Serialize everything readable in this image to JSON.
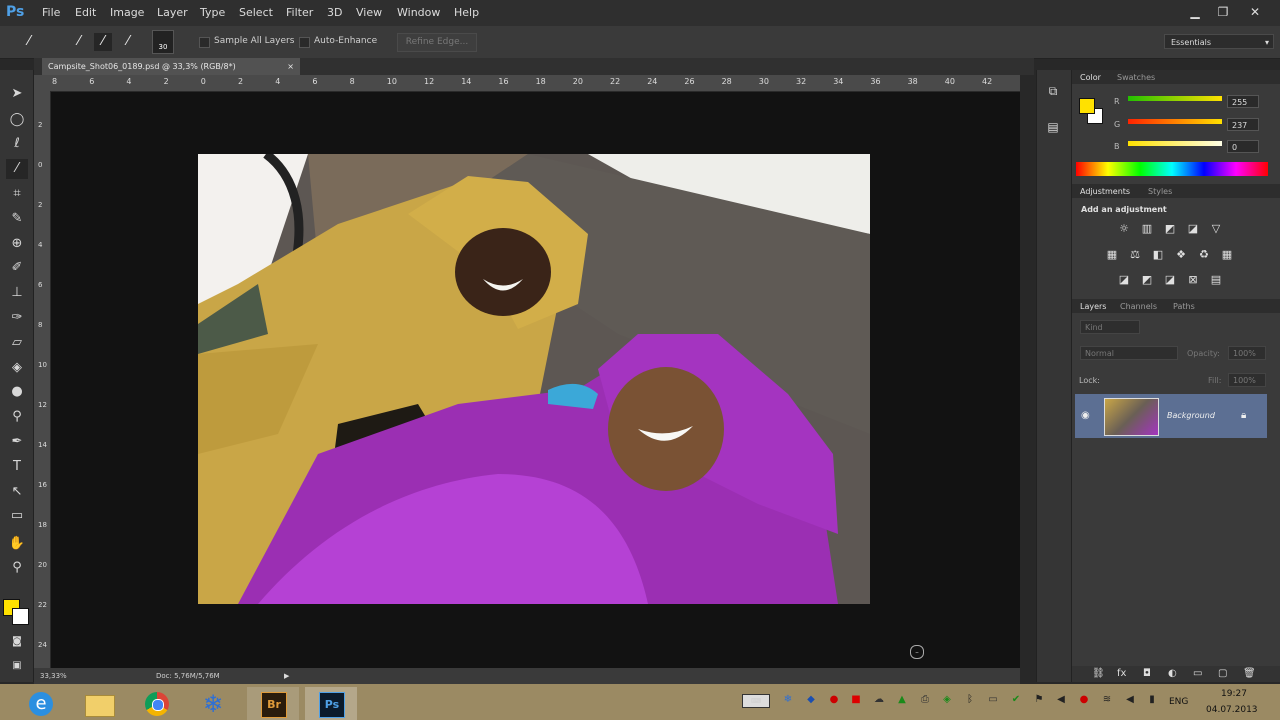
{
  "app": {
    "logo": "Ps",
    "menu": [
      "File",
      "Edit",
      "Image",
      "Layer",
      "Type",
      "Select",
      "Filter",
      "3D",
      "View",
      "Window",
      "Help"
    ],
    "window_controls": [
      "minimize-icon",
      "restore-icon",
      "close-icon"
    ]
  },
  "options_bar": {
    "brush_size": "30",
    "sample_all_layers": "Sample All Layers",
    "auto_enhance": "Auto-Enhance",
    "refine_edge": "Refine Edge...",
    "workspace": "Essentials"
  },
  "document": {
    "tab_title": "Campsite_Shot06_0189.psd @ 33,3% (RGB/8*)",
    "tab_close": "×",
    "ruler_h": [
      "8",
      "6",
      "4",
      "2",
      "0",
      "2",
      "4",
      "6",
      "8",
      "10",
      "12",
      "14",
      "16",
      "18",
      "20",
      "22",
      "24",
      "26",
      "28",
      "30",
      "32",
      "34",
      "36",
      "38",
      "40",
      "42"
    ],
    "ruler_v": [
      "2",
      "0",
      "2",
      "4",
      "6",
      "8",
      "10",
      "12",
      "14",
      "16",
      "18",
      "20",
      "22",
      "24"
    ],
    "zoom": "33,33%",
    "doc_size": "Doc: 5,76M/5,76M"
  },
  "color_panel": {
    "tabs": [
      "Color",
      "Swatches"
    ],
    "fg_color": "#ffe100",
    "bg_color": "#ffffff",
    "r_label": "R",
    "r_value": "255",
    "g_label": "G",
    "g_value": "237",
    "b_label": "B",
    "b_value": "0"
  },
  "adjustments_panel": {
    "tabs": [
      "Adjustments",
      "Styles"
    ],
    "heading": "Add an adjustment"
  },
  "layers_panel": {
    "tabs": [
      "Layers",
      "Channels",
      "Paths"
    ],
    "kind": "Kind",
    "blend_mode": "Normal",
    "opacity_label": "Opacity:",
    "opacity_value": "100%",
    "lock_label": "Lock:",
    "fill_label": "Fill:",
    "fill_value": "100%",
    "layers": [
      {
        "name": "Background",
        "visible": true,
        "locked": true
      }
    ]
  },
  "taskbar": {
    "apps": [
      "internet-explorer",
      "file-explorer",
      "chrome",
      "snowflake-app",
      "bridge",
      "photoshop"
    ],
    "bridge_label": "Br",
    "ps_label": "Ps",
    "lang": "ENG",
    "time": "19:27",
    "date": "04.07.2013"
  }
}
